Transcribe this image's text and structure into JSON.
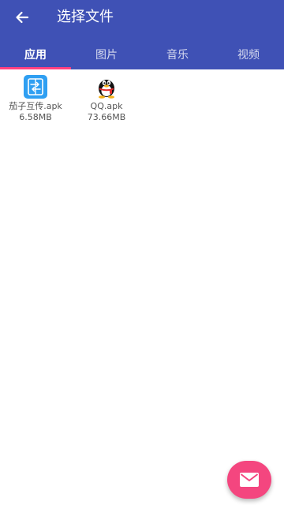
{
  "app": {
    "title": "选择文件",
    "colors": {
      "primary": "#3f51b5",
      "accent": "#ff4081",
      "fab": "#f4467f"
    }
  },
  "toolbar": {
    "back_icon": "arrow-left-icon"
  },
  "tabs": [
    {
      "label": "应用",
      "active": true
    },
    {
      "label": "图片",
      "active": false
    },
    {
      "label": "音乐",
      "active": false
    },
    {
      "label": "视频",
      "active": false
    }
  ],
  "files": [
    {
      "name": "茄子互传.apk",
      "size": "6.58MB",
      "icon": "app-transfer-icon"
    },
    {
      "name": "QQ.apk",
      "size": "73.66MB",
      "icon": "qq-penguin-icon"
    }
  ],
  "fab": {
    "icon": "mail-icon"
  }
}
